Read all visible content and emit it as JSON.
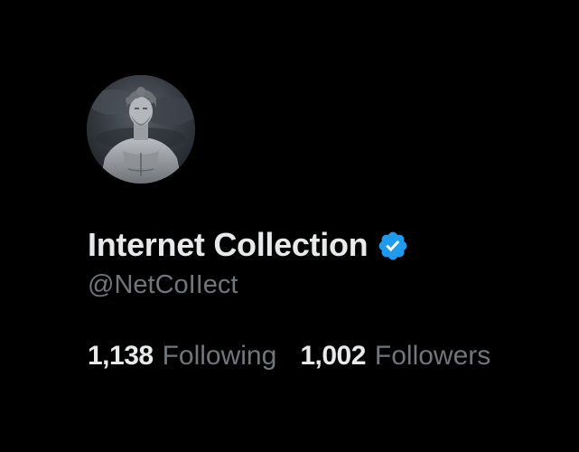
{
  "profile": {
    "display_name": "Internet Collection",
    "handle": "@NetCoIIect",
    "verified": true,
    "avatar_icon": "statue-avatar",
    "stats": [
      {
        "count": "1,138",
        "label": "Following"
      },
      {
        "count": "1,002",
        "label": "Followers"
      }
    ]
  },
  "colors": {
    "background": "#000000",
    "primary_text": "#e7e9ea",
    "secondary_text": "#71767b",
    "verified_badge": "#1d9bf0"
  }
}
